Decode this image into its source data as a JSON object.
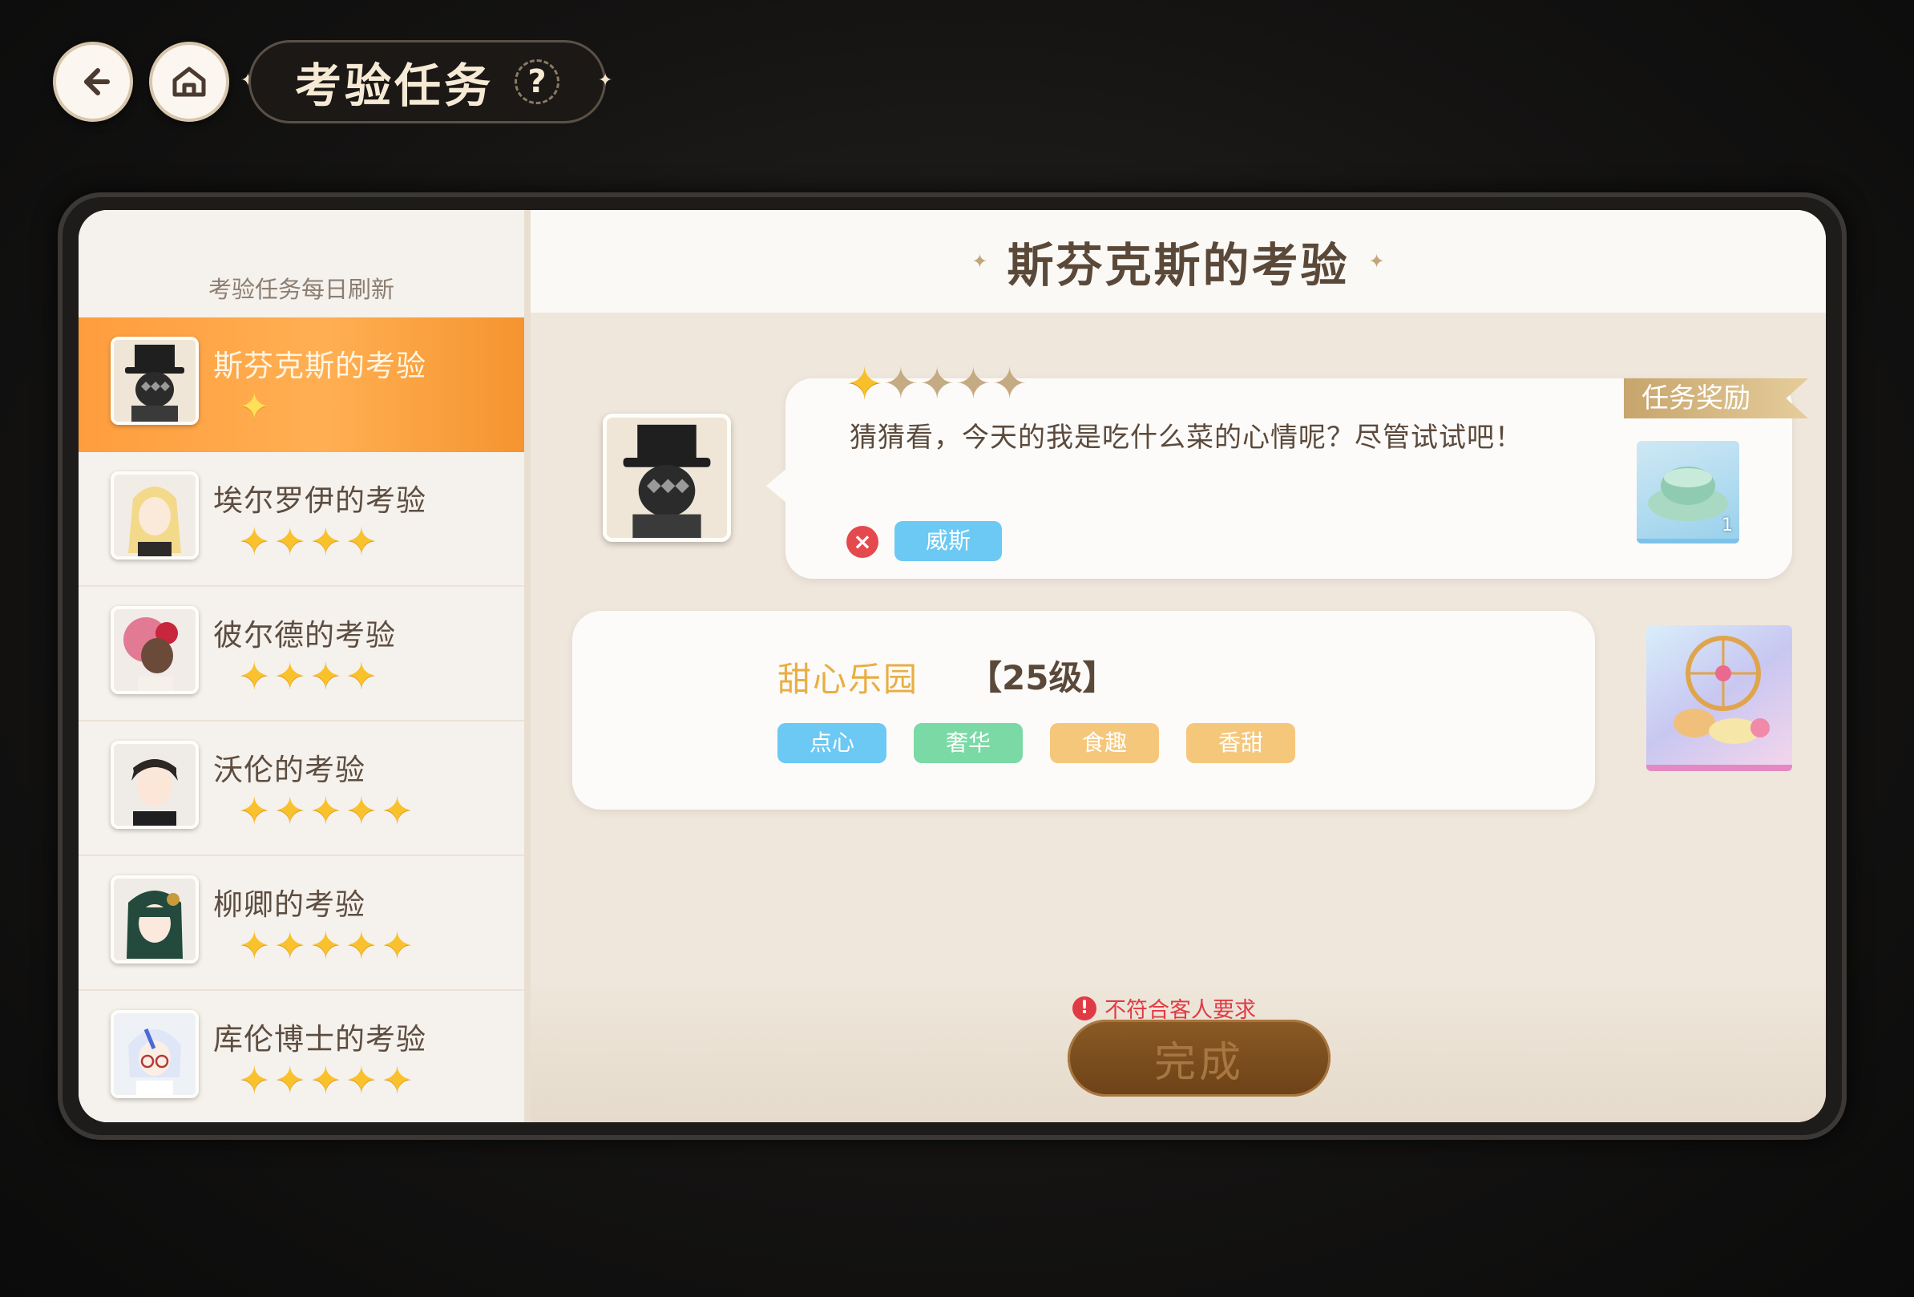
{
  "header": {
    "title": "考验任务",
    "back_icon": "arrow-left-icon",
    "home_icon": "home-icon",
    "help_label": "?"
  },
  "sidebar": {
    "refresh_note": "考验任务每日刷新",
    "items": [
      {
        "label": "斯芬克斯的考验",
        "stars": 1,
        "active": true
      },
      {
        "label": "埃尔罗伊的考验",
        "stars": 4,
        "active": false
      },
      {
        "label": "彼尔德的考验",
        "stars": 4,
        "active": false
      },
      {
        "label": "沃伦的考验",
        "stars": 5,
        "active": false
      },
      {
        "label": "柳卿的考验",
        "stars": 5,
        "active": false
      },
      {
        "label": "库伦博士的考验",
        "stars": 5,
        "active": false
      }
    ]
  },
  "main": {
    "title": "斯芬克斯的考验",
    "request": {
      "difficulty": 1,
      "quote": "猜猜看，今天的我是吃什么菜的心情呢？尽管试试吧！",
      "taste_tag": "威斯",
      "taste_status": "unmet"
    },
    "reward": {
      "label": "任务奖励",
      "quantity": "1",
      "icon": "teacup-icon"
    },
    "dish": {
      "name": "甜心乐园",
      "level": "【25级】",
      "tags": [
        {
          "label": "点心",
          "color": "#6cc9f3"
        },
        {
          "label": "奢华",
          "color": "#7ad9a4"
        },
        {
          "label": "食趣",
          "color": "#f5c77a"
        },
        {
          "label": "香甜",
          "color": "#f5c77a"
        }
      ]
    },
    "warning": "不符合客人要求",
    "complete_label": "完成"
  },
  "colors": {
    "accent_orange": "#ffa547",
    "star_gold": "#f9c22c",
    "warning_red": "#e03b45",
    "button_brown": "#7a4c1e"
  }
}
